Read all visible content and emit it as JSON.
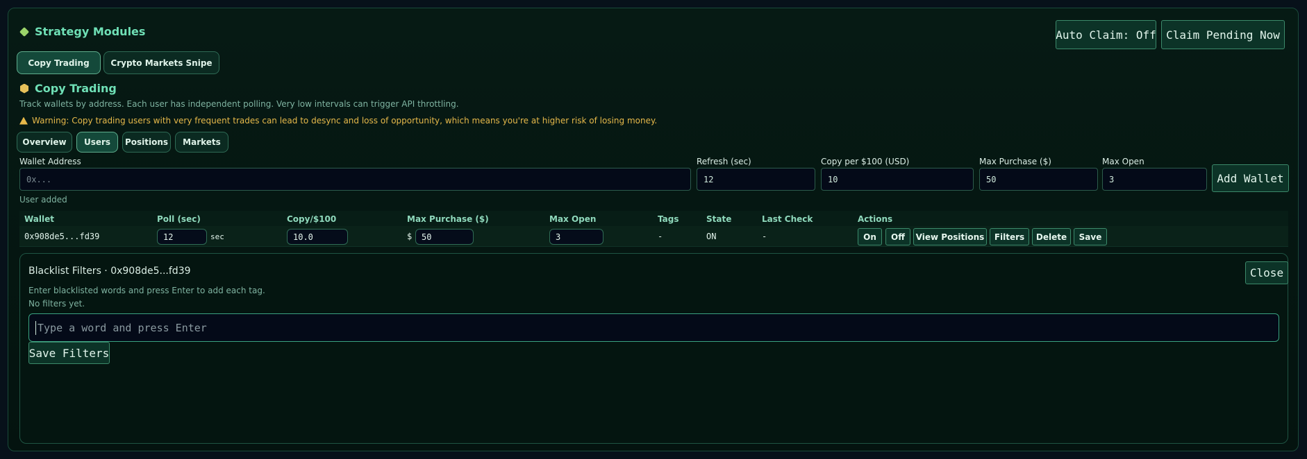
{
  "header": {
    "title": "Strategy Modules",
    "auto_claim_label": "Auto Claim: Off",
    "claim_pending_label": "Claim Pending Now"
  },
  "strategy_tabs": [
    {
      "label": "Copy Trading",
      "active": true
    },
    {
      "label": "Crypto Markets Snipe",
      "active": false
    }
  ],
  "section": {
    "title": "Copy Trading",
    "description": "Track wallets by address. Each user has independent polling. Very low intervals can trigger API throttling.",
    "warning": "Warning: Copy trading users with very frequent trades can lead to desync and loss of opportunity, which means you're at higher risk of losing money."
  },
  "sub_tabs": [
    {
      "label": "Overview",
      "active": false
    },
    {
      "label": "Users",
      "active": true
    },
    {
      "label": "Positions",
      "active": false
    },
    {
      "label": "Markets",
      "active": false
    }
  ],
  "form": {
    "wallet_label": "Wallet Address",
    "wallet_placeholder": "0x...",
    "refresh_label": "Refresh (sec)",
    "refresh_value": "12",
    "copy_label": "Copy per $100 (USD)",
    "copy_value": "10",
    "max_purchase_label": "Max Purchase ($)",
    "max_purchase_value": "50",
    "max_open_label": "Max Open",
    "max_open_value": "3",
    "add_wallet_label": "Add Wallet",
    "status_message": "User added"
  },
  "table": {
    "headers": [
      "Wallet",
      "Poll (sec)",
      "Copy/$100",
      "Max Purchase ($)",
      "Max Open",
      "Tags",
      "State",
      "Last Check",
      "Actions"
    ],
    "row": {
      "wallet": "0x908de5...fd39",
      "poll": "12",
      "poll_unit": "sec",
      "copy": "10.0",
      "currency": "$",
      "max_purchase": "50",
      "max_open": "3",
      "tags": "-",
      "state": "ON",
      "last_check": "-",
      "actions": [
        "On",
        "Off",
        "View Positions",
        "Filters",
        "Delete",
        "Save"
      ]
    }
  },
  "filters": {
    "title": "Blacklist Filters · 0x908de5...fd39",
    "close_label": "Close",
    "hint": "Enter blacklisted words and press Enter to add each tag.",
    "empty": "No filters yet.",
    "input_placeholder": "Type a word and press Enter",
    "save_label": "Save Filters"
  },
  "colors": {
    "accent": "#6fe0b6",
    "warning": "#e6b84a",
    "background": "#07111a"
  }
}
